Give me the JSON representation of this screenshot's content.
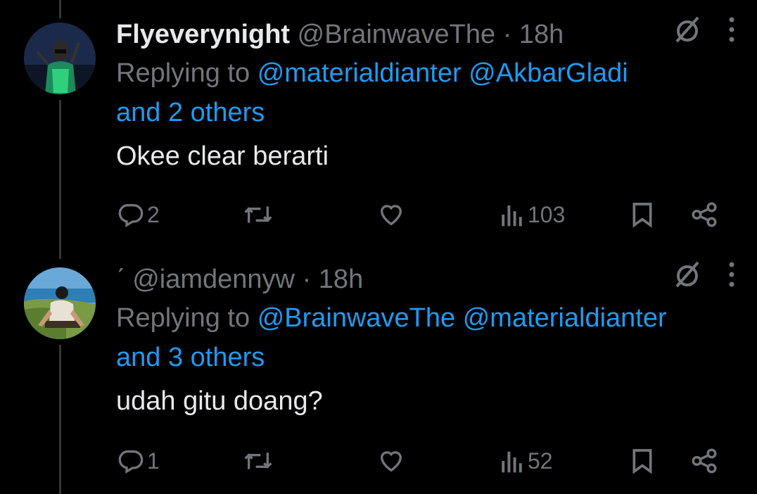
{
  "tweets": [
    {
      "name": "Flyeverynight",
      "handle": "@BrainwaveThe",
      "dot": "·",
      "time": "18h",
      "replying_prefix": "Replying to",
      "replying_mentions": [
        "@materialdianter",
        "@AkbarGladi"
      ],
      "replying_others": "and 2 others",
      "text": "Okee clear berarti",
      "replies": "2",
      "views": "103"
    },
    {
      "name": "ˊ",
      "handle": "@iamdennyw",
      "dot": "·",
      "time": "18h",
      "replying_prefix": "Replying to",
      "replying_mentions": [
        "@BrainwaveThe",
        "@materialdianter"
      ],
      "replying_others": "and 3 others",
      "text": "udah gitu doang?",
      "replies": "1",
      "views": "52"
    }
  ],
  "icons": {
    "reply": "reply-icon",
    "repost": "repost-icon",
    "like": "heart-icon",
    "views": "views-icon",
    "bookmark": "bookmark-icon",
    "share": "share-icon",
    "grok": "grok-icon",
    "more": "more-icon"
  },
  "colors": {
    "background": "#000000",
    "text": "#e7e9ea",
    "muted": "#71767b",
    "accent": "#1d9bf0"
  }
}
